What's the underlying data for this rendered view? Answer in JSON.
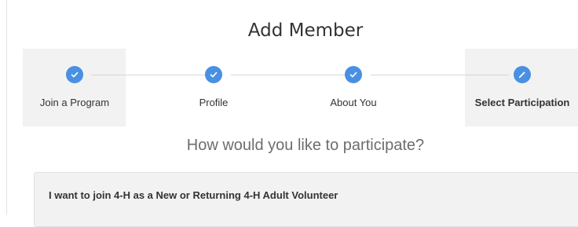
{
  "page": {
    "title": "Add Member",
    "question": "How would you like to participate?"
  },
  "stepper": {
    "steps": [
      {
        "label": "Join a Program",
        "status": "complete",
        "icon": "check-icon"
      },
      {
        "label": "Profile",
        "status": "complete",
        "icon": "check-icon"
      },
      {
        "label": "About You",
        "status": "complete",
        "icon": "check-icon"
      },
      {
        "label": "Select Participation",
        "status": "current",
        "icon": "pencil-icon"
      }
    ]
  },
  "options": [
    {
      "label": "I want to join 4-H as a New or Returning 4-H Adult Volunteer"
    }
  ],
  "colors": {
    "accent": "#4a90e2",
    "step_highlight": "#f2f2f2",
    "text": "#333333",
    "question_text": "#6d6d6d"
  }
}
